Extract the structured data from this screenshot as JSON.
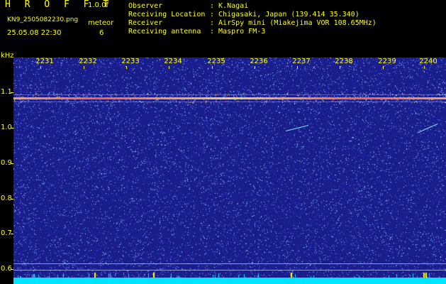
{
  "header": {
    "title": "H R O F F T",
    "version": "1.0.0f",
    "filename": "KN9_2505082230.png",
    "datetime": "25.05.08 22:30",
    "count_label": "meteor",
    "count_value": "6",
    "info": [
      {
        "label": "Observer",
        "value": ": K.Nagai"
      },
      {
        "label": "Receiving Location",
        "value": ": Chigasaki, Japan (139.414 35.340)"
      },
      {
        "label": "Receiver",
        "value": ": AirSpy mini (Miakejima VOR 108.65MHz)"
      },
      {
        "label": "Receiving antenna",
        "value": ": Maspro FM-3"
      }
    ]
  },
  "axis": {
    "freq_unit": "kHz",
    "freq_ticks": [
      "1.1",
      "1.0",
      "0.9",
      "0.8",
      "0.7",
      "0.6"
    ],
    "time_ticks": [
      "2231",
      "2232",
      "2233",
      "2234",
      "2235",
      "2236",
      "2237",
      "2238",
      "2239",
      "2240"
    ]
  },
  "colors": {
    "background": "#000000",
    "text": "#ffff00",
    "plot": "#1a1d8c",
    "signal_line": "#ff6a4a",
    "meteor": "#7fe6ff",
    "bottom_bar": "#00e5ff"
  },
  "meteor_count": 6
}
